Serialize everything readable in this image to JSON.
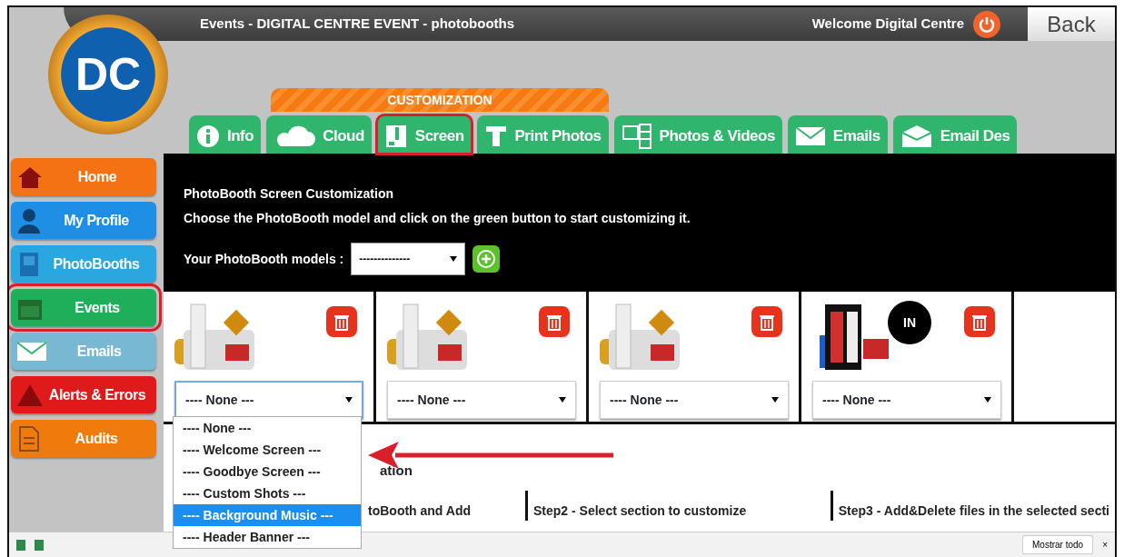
{
  "header": {
    "title": "Events - DIGITAL CENTRE EVENT - photobooths",
    "welcome": "Welcome Digital Centre",
    "back": "Back"
  },
  "logo": {
    "text": "DC"
  },
  "section_tab": "CUSTOMIZATION",
  "tabs": [
    {
      "label": "Info",
      "highlighted": false
    },
    {
      "label": "Cloud",
      "highlighted": false
    },
    {
      "label": "Screen",
      "highlighted": true
    },
    {
      "label": "Print Photos",
      "highlighted": false
    },
    {
      "label": "Photos & Videos",
      "highlighted": false
    },
    {
      "label": "Emails",
      "highlighted": false
    },
    {
      "label": "Email Des",
      "highlighted": false
    }
  ],
  "sidebar": [
    {
      "label": "Home",
      "color": "#f47214",
      "highlighted": false
    },
    {
      "label": "My Profile",
      "color": "#1f8fe6",
      "highlighted": false
    },
    {
      "label": "PhotoBooths",
      "color": "#2aa7e0",
      "highlighted": false
    },
    {
      "label": "Events",
      "color": "#1fae5a",
      "highlighted": true
    },
    {
      "label": "Emails",
      "color": "#79b8d2",
      "highlighted": false
    },
    {
      "label": "Alerts & Errors",
      "color": "#e01a1a",
      "highlighted": false
    },
    {
      "label": "Audits",
      "color": "#f07a0c",
      "highlighted": false
    }
  ],
  "panel": {
    "title": "PhotoBooth Screen Customization",
    "instruction": "Choose the PhotoBooth model and click on the green button to start customizing it.",
    "models_label": "Your PhotoBooth models :",
    "models_value": "--------------"
  },
  "booths": [
    {
      "kind": "kiosk",
      "value": "---- None ---",
      "focused": true
    },
    {
      "kind": "kiosk",
      "value": "---- None ---",
      "focused": false
    },
    {
      "kind": "kiosk",
      "value": "---- None ---",
      "focused": false
    },
    {
      "kind": "cabinet",
      "badge": "IN",
      "value": "---- None ---",
      "focused": false
    }
  ],
  "dropdown": {
    "options": [
      {
        "label": "---- None ---",
        "selected": false
      },
      {
        "label": "---- Welcome Screen ---",
        "selected": false
      },
      {
        "label": "---- Goodbye Screen ---",
        "selected": false
      },
      {
        "label": "---- Custom Shots ---",
        "selected": false
      },
      {
        "label": "---- Background Music ---",
        "selected": true
      },
      {
        "label": "---- Header Banner ---",
        "selected": false
      }
    ]
  },
  "partial_heading": "ation",
  "steps": [
    "toBooth and Add",
    "Step2 - Select section to customize",
    "Step3 - Add&Delete files in the selected secti"
  ],
  "callout_arrow": true,
  "download_bar": {
    "button": "Mostrar todo",
    "close": "×"
  }
}
